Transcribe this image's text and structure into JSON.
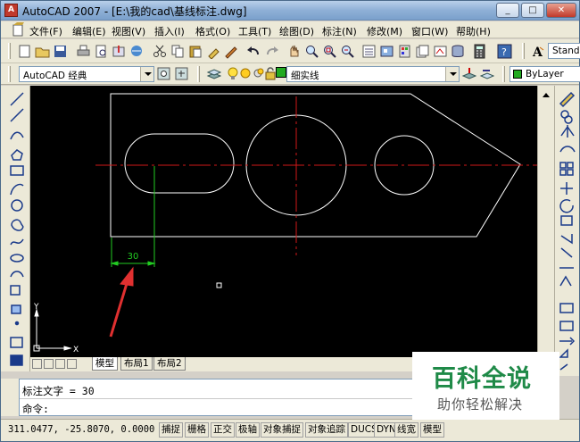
{
  "window": {
    "title": "AutoCAD 2007 - [E:\\我的cad\\基线标注.dwg]",
    "controls": [
      "_",
      "□",
      "✕"
    ]
  },
  "menu": [
    "文件(F)",
    "编辑(E)",
    "视图(V)",
    "插入(I)",
    "格式(O)",
    "工具(T)",
    "绘图(D)",
    "标注(N)",
    "修改(M)",
    "窗口(W)",
    "帮助(H)"
  ],
  "toolbar": {
    "workspace": "AutoCAD 经典",
    "layer": "细实线",
    "color": "ByLayer",
    "text_style": "Stand"
  },
  "drawing": {
    "dimension_text": "30",
    "ucs_x": "X",
    "ucs_y": "Y",
    "colors": {
      "outline": "#ffffff",
      "centerline": "#d01818",
      "dimension": "#22cc22",
      "arrow": "#e03030"
    }
  },
  "tabs": [
    "模型",
    "布局1",
    "布局2"
  ],
  "command": {
    "line1": "标注文字 = 30",
    "line2": "命令:"
  },
  "status": {
    "coords": "311.0477, -25.8070, 0.0000",
    "buttons": [
      "捕捉",
      "栅格",
      "正交",
      "极轴",
      "对象捕捉",
      "对象追踪",
      "DUCS",
      "DYN",
      "线宽",
      "模型"
    ]
  },
  "watermark": {
    "brand": "百科全说",
    "tagline": "助你轻松解决"
  }
}
